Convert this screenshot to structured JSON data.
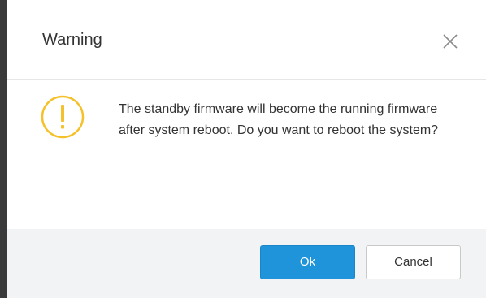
{
  "dialog": {
    "title": "Warning",
    "close_icon": "close-icon",
    "warning_icon": "exclamation-circle-icon",
    "message": "The standby firmware will become the running firmware after system reboot. Do you want to reboot the system?",
    "buttons": {
      "ok_label": "Ok",
      "cancel_label": "Cancel"
    }
  },
  "colors": {
    "warning_accent": "#f5c12a",
    "primary_button": "#1f94db",
    "footer_background": "#f2f3f5"
  }
}
